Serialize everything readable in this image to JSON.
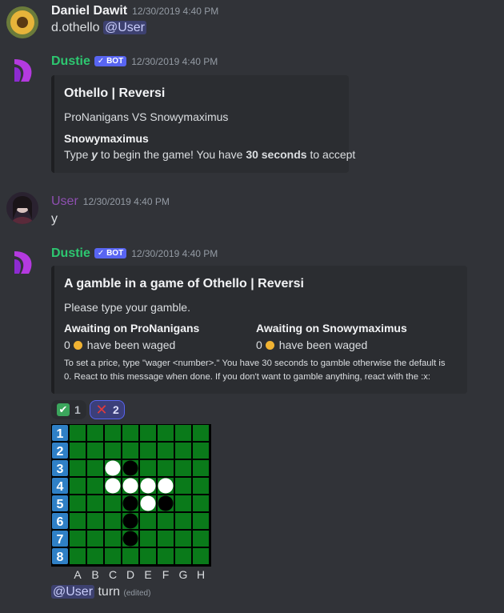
{
  "messages": [
    {
      "author": "Daniel Dawit",
      "timestamp": "12/30/2019 4:40 PM",
      "text": "d.othello",
      "mention": "@User"
    },
    {
      "author": "Dustie",
      "bot_tag": "BOT",
      "timestamp": "12/30/2019 4:40 PM",
      "embed": {
        "title": "Othello | Reversi",
        "line1": "ProNanigans VS Snowymaximus",
        "field_name": "Snowymaximus",
        "field_value": {
          "pre": "Type ",
          "y": "y",
          "mid": " to begin the game! You have ",
          "bold": "30 seconds",
          "post": " to accept"
        }
      }
    },
    {
      "author": "User",
      "timestamp": "12/30/2019 4:40 PM",
      "text": "y"
    },
    {
      "author": "Dustie",
      "bot_tag": "BOT",
      "timestamp": "12/30/2019 4:40 PM",
      "embed": {
        "title": "A gamble in a game of Othello | Reversi",
        "description": "Please type your gamble.",
        "fields": [
          {
            "name": "Awaiting on ProNanigans",
            "amount": "0",
            "suffix": "have been waged"
          },
          {
            "name": "Awaiting on Snowymaximus",
            "amount": "0",
            "suffix": "have been waged"
          }
        ],
        "footer_line1": "To set a price, type \"wager <number>.\" You have 30 seconds to gamble otherwise the default is",
        "footer_line2": "0. React to this message when done. If you don't want to gamble anything, react with the :x:"
      },
      "reactions": [
        {
          "icon": "check-mark-icon",
          "count": "1",
          "selected": false
        },
        {
          "icon": "cross-mark-icon",
          "count": "2",
          "selected": true
        }
      ]
    }
  ],
  "board": {
    "row_labels": [
      "1",
      "2",
      "3",
      "4",
      "5",
      "6",
      "7",
      "8"
    ],
    "col_labels": [
      "A",
      "B",
      "C",
      "D",
      "E",
      "F",
      "G",
      "H"
    ],
    "cells": [
      "........",
      "........",
      "..WB....",
      "..WWWW..",
      "...BWB..",
      "...B....",
      "...B....",
      "........"
    ]
  },
  "turn": {
    "mention": "@User",
    "text": "turn",
    "edited": "(edited)"
  },
  "colors": {
    "background": "#313338",
    "dustie_name": "#2dc770",
    "user_name": "#8e4fb0",
    "mention_bg": "#5865f2",
    "board_green": "#0a7a1a",
    "row_label_bg": "#2f80c6"
  }
}
